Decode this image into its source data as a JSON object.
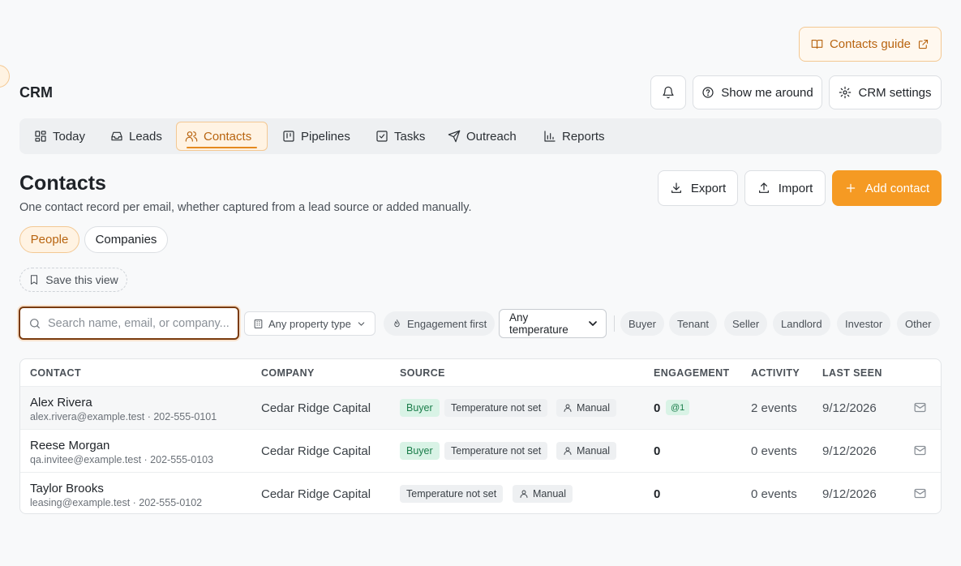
{
  "guide": {
    "label": "Contacts guide"
  },
  "app": {
    "title": "CRM"
  },
  "header": {
    "tour_label": "Show me around",
    "settings_label": "CRM settings"
  },
  "tabs": [
    {
      "label": "Today",
      "icon": "grid-icon"
    },
    {
      "label": "Leads",
      "icon": "inbox-icon"
    },
    {
      "label": "Contacts",
      "icon": "users-icon",
      "active": true
    },
    {
      "label": "Pipelines",
      "icon": "kanban-icon"
    },
    {
      "label": "Tasks",
      "icon": "checkbox-icon"
    },
    {
      "label": "Outreach",
      "icon": "send-icon"
    },
    {
      "label": "Reports",
      "icon": "bar-chart-icon"
    }
  ],
  "page": {
    "title": "Contacts",
    "subtitle": "One contact record per email, whether captured from a lead source or added manually."
  },
  "actions": {
    "export": "Export",
    "import": "Import",
    "add": "Add contact"
  },
  "views": {
    "people": "People",
    "companies": "Companies",
    "save_view": "Save this view"
  },
  "filters": {
    "search_placeholder": "Search name, email, or company...",
    "property_type": "Any property type",
    "engagement": "Engagement first",
    "temperature": "Any temperature",
    "roles": [
      "Buyer",
      "Tenant",
      "Seller",
      "Landlord",
      "Investor",
      "Other"
    ]
  },
  "table": {
    "headers": {
      "contact": "CONTACT",
      "company": "COMPANY",
      "source": "SOURCE",
      "engagement": "ENGAGEMENT",
      "activity": "ACTIVITY",
      "last_seen": "LAST SEEN"
    },
    "rows": [
      {
        "name": "Alex Rivera",
        "sub": "alex.rivera@example.test · 202-555-0101",
        "company": "Cedar Ridge Capital",
        "role": "Buyer",
        "temperature": "Temperature not set",
        "source": "Manual",
        "engagement": "0",
        "engagement_badge": "@1",
        "activity": "2 events",
        "last_seen": "9/12/2026"
      },
      {
        "name": "Reese Morgan",
        "sub": "qa.invitee@example.test · 202-555-0103",
        "company": "Cedar Ridge Capital",
        "role": "Buyer",
        "temperature": "Temperature not set",
        "source": "Manual",
        "engagement": "0",
        "activity": "0 events",
        "last_seen": "9/12/2026"
      },
      {
        "name": "Taylor Brooks",
        "sub": "leasing@example.test · 202-555-0102",
        "company": "Cedar Ridge Capital",
        "temperature": "Temperature not set",
        "source": "Manual",
        "engagement": "0",
        "activity": "0 events",
        "last_seen": "9/12/2026"
      }
    ]
  },
  "colors": {
    "accent": "#f59a23",
    "accent_text": "#b86410",
    "buyer_bg": "#d9f3e6",
    "buyer_text": "#1a7d4a"
  }
}
